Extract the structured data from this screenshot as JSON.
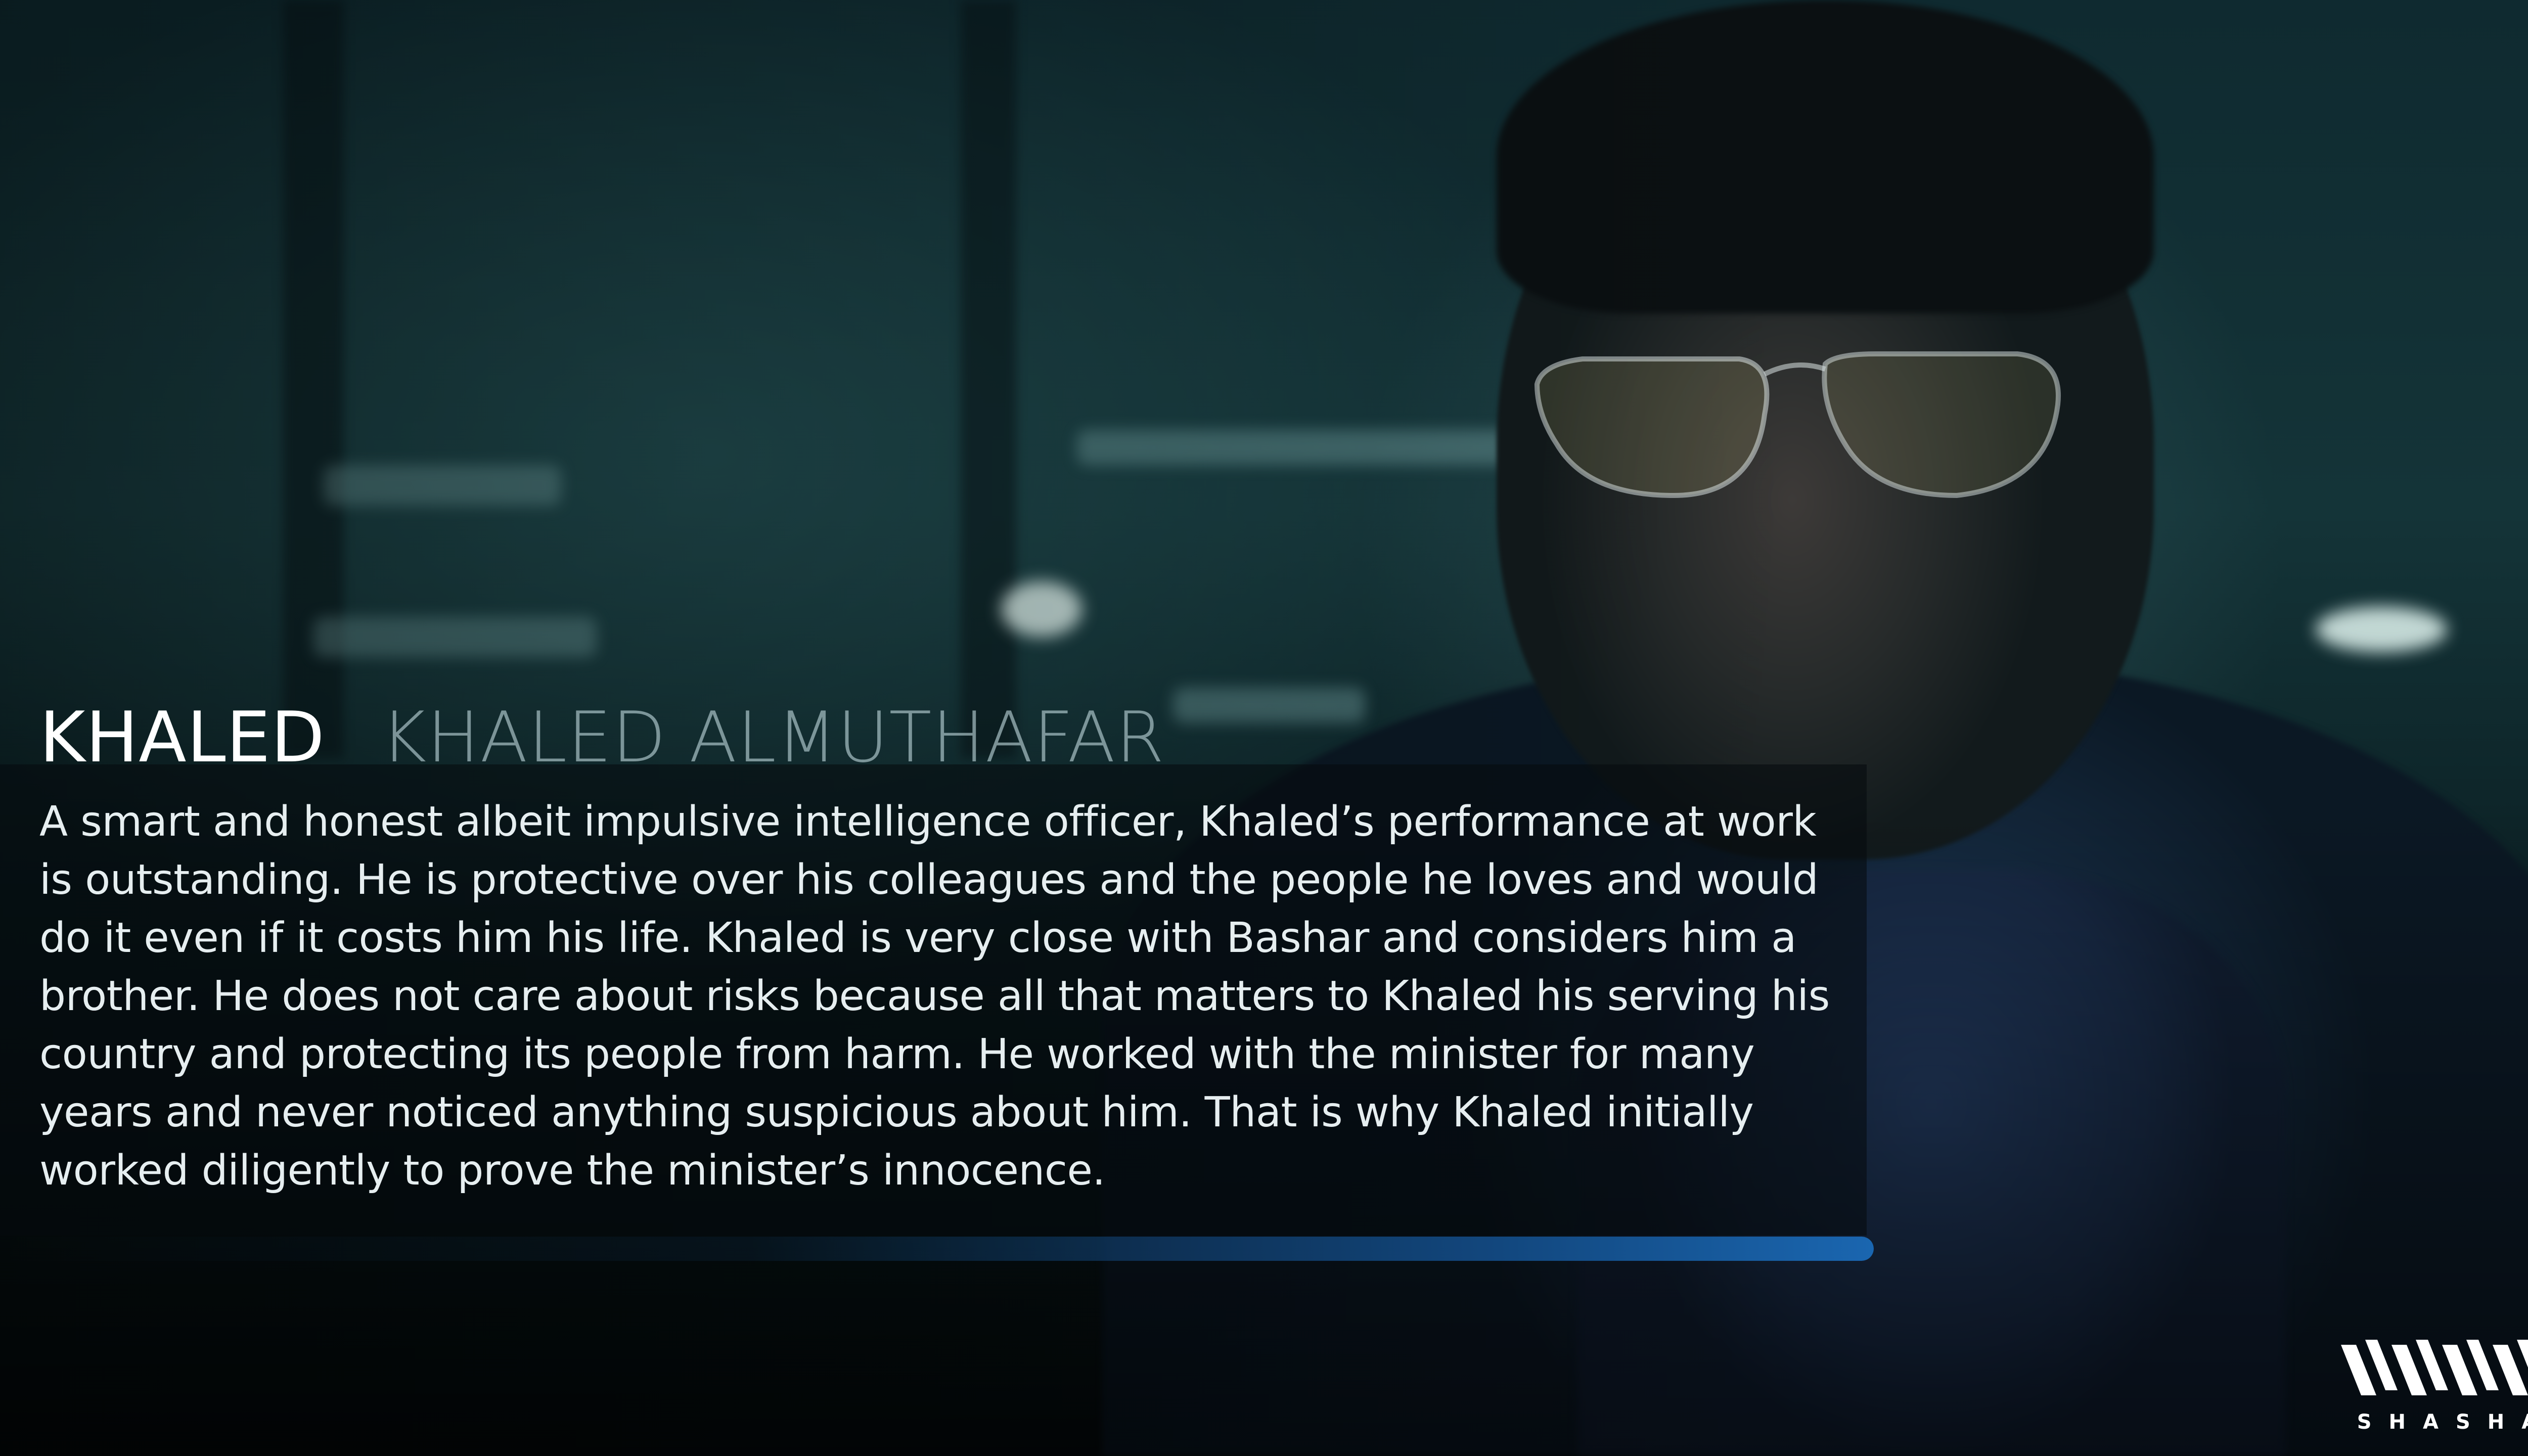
{
  "character": {
    "name": "KHALED",
    "actor": "KHALED ALMUTHAFAR",
    "bio": "A smart and honest albeit impulsive intelligence officer, Khaled’s performance at work is outstanding. He is protective over his colleagues and the people he loves and would do it even if it costs him his life. Khaled is very close with Bashar and considers him a brother. He does not care about risks because all that matters to Khaled his serving his country and protecting its people from harm. He worked with the minister for many years and never noticed anything suspicious about him. That is why Khaled initially worked diligently to prove the minister’s innocence."
  },
  "progress": {
    "value_fraction": 1.0,
    "color": "#1a66b0"
  },
  "brand": {
    "logo_text": "SHASHA",
    "icon": "shasha-logo-icon"
  },
  "colors": {
    "title": "#ffffff",
    "subtitle": "#bed7dc",
    "text": "#e6eef0",
    "panel": "#050a0e"
  }
}
